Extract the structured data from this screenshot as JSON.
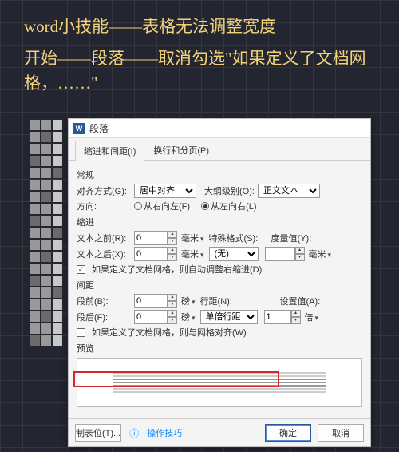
{
  "annotation": {
    "line1": "word小技能——表格无法调整宽度",
    "line2": "开始——段落——取消勾选\"如果定义了文档网格，……\""
  },
  "dialog": {
    "title": "段落",
    "tabs": {
      "indent": "缩进和间距(I)",
      "pagebreak": "换行和分页(P)"
    },
    "general": {
      "label": "常规",
      "align_label": "对齐方式(G):",
      "align_value": "居中对齐",
      "outline_label": "大纲级别(O):",
      "outline_value": "正文文本",
      "direction_label": "方向:",
      "rtl": "从右向左(F)",
      "ltr": "从左向右(L)"
    },
    "indent": {
      "label": "缩进",
      "before_label": "文本之前(R):",
      "before_value": "0",
      "after_label": "文本之后(X):",
      "after_value": "0",
      "char_unit": "毫米",
      "special_label": "特殊格式(S):",
      "special_value": "(无)",
      "by_label": "度量值(Y):",
      "by_unit": "毫米",
      "grid_checkbox": "如果定义了文档网格，则自动调整右缩进(D)"
    },
    "spacing": {
      "label": "间距",
      "before_label": "段前(B):",
      "before_value": "0",
      "after_label": "段后(F):",
      "after_value": "0",
      "line_unit": "磅",
      "linespace_label": "行距(N):",
      "linespace_value": "单倍行距",
      "at_label": "设置值(A):",
      "at_value": "1",
      "at_unit": "倍",
      "grid_checkbox": "如果定义了文档网格，则与网格对齐(W)"
    },
    "preview_label": "预览",
    "buttons": {
      "tabs_btn": "制表位(T)...",
      "tips": "操作技巧",
      "ok": "确定",
      "cancel": "取消"
    }
  }
}
